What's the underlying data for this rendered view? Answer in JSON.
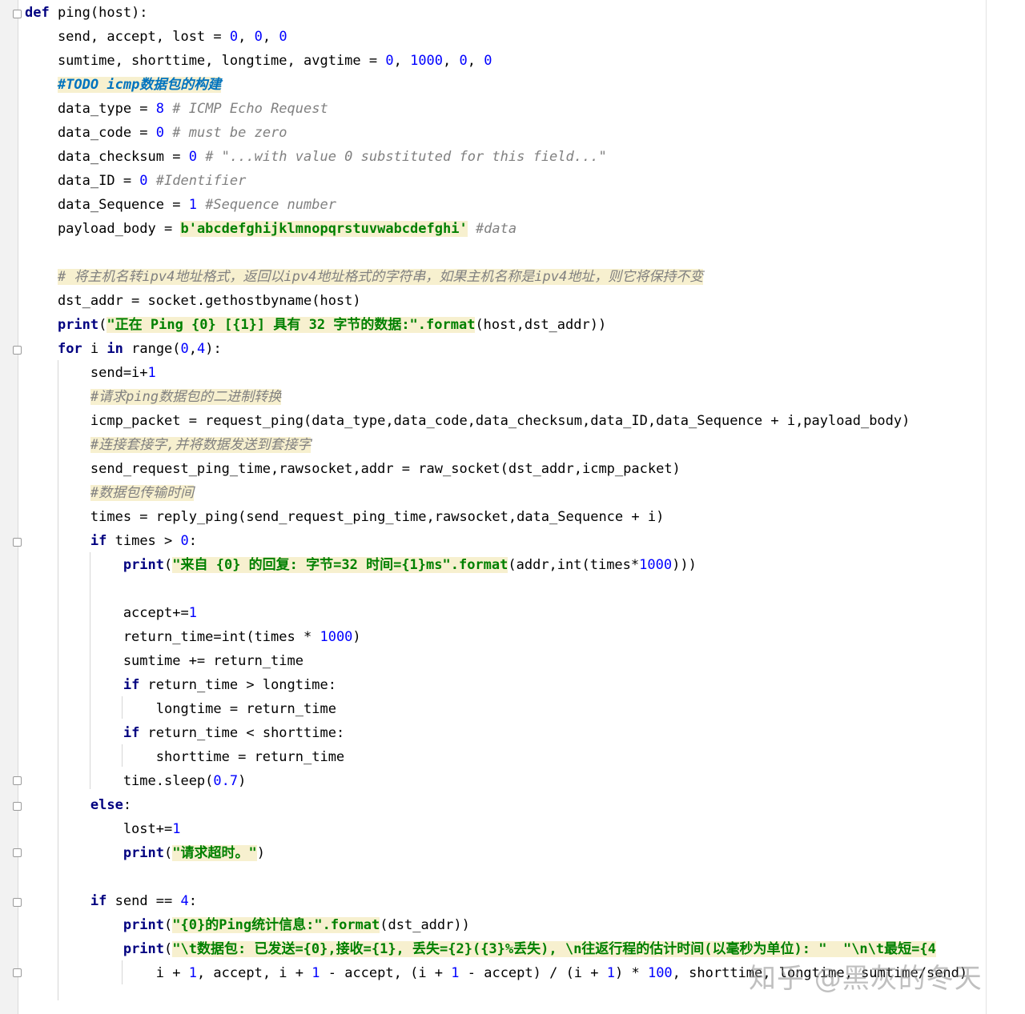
{
  "editor": {
    "lines": [
      [
        {
          "t": "def",
          "c": "kw"
        },
        {
          "t": " ping(host):"
        }
      ],
      [
        {
          "t": "    send, accept, lost = "
        },
        {
          "t": "0",
          "c": "num"
        },
        {
          "t": ", "
        },
        {
          "t": "0",
          "c": "num"
        },
        {
          "t": ", "
        },
        {
          "t": "0",
          "c": "num"
        }
      ],
      [
        {
          "t": "    sumtime, shorttime, longtime, avgtime = "
        },
        {
          "t": "0",
          "c": "num"
        },
        {
          "t": ", "
        },
        {
          "t": "1000",
          "c": "num"
        },
        {
          "t": ", "
        },
        {
          "t": "0",
          "c": "num"
        },
        {
          "t": ", "
        },
        {
          "t": "0",
          "c": "num"
        }
      ],
      [
        {
          "t": "    "
        },
        {
          "t": "#TODO icmp数据包的构建",
          "c": "todo"
        }
      ],
      [
        {
          "t": "    data_type = "
        },
        {
          "t": "8",
          "c": "num"
        },
        {
          "t": " # ICMP Echo Request",
          "c": "cmt"
        }
      ],
      [
        {
          "t": "    data_code = "
        },
        {
          "t": "0",
          "c": "num"
        },
        {
          "t": " # must be zero",
          "c": "cmt"
        }
      ],
      [
        {
          "t": "    data_checksum = "
        },
        {
          "t": "0",
          "c": "num"
        },
        {
          "t": " # \"...with value 0 substituted for this field...\"",
          "c": "cmt"
        }
      ],
      [
        {
          "t": "    data_ID = "
        },
        {
          "t": "0",
          "c": "num"
        },
        {
          "t": " #Identifier",
          "c": "cmt"
        }
      ],
      [
        {
          "t": "    data_Sequence = "
        },
        {
          "t": "1",
          "c": "num"
        },
        {
          "t": " #Sequence number",
          "c": "cmt"
        }
      ],
      [
        {
          "t": "    payload_body = "
        },
        {
          "t": "b'abcdefghijklmnopqrstuvwabcdefghi'",
          "c": "str"
        },
        {
          "t": " #data",
          "c": "cmt"
        }
      ],
      [
        {
          "t": ""
        }
      ],
      [
        {
          "t": "    "
        },
        {
          "t": "# 将主机名转ipv4地址格式，返回以ipv4地址格式的字符串，如果主机名称是ipv4地址，则它将保持不变",
          "c": "cmt-hl"
        }
      ],
      [
        {
          "t": "    dst_addr = socket.gethostbyname(host)"
        }
      ],
      [
        {
          "t": "    "
        },
        {
          "t": "print",
          "c": "kw"
        },
        {
          "t": "("
        },
        {
          "t": "\"正在 Ping {0} [{1}] 具有 32 字节的数据:\".format",
          "c": "str"
        },
        {
          "t": "(host,dst_addr))"
        }
      ],
      [
        {
          "t": "    "
        },
        {
          "t": "for",
          "c": "kw"
        },
        {
          "t": " i "
        },
        {
          "t": "in",
          "c": "kw"
        },
        {
          "t": " range("
        },
        {
          "t": "0",
          "c": "num"
        },
        {
          "t": ","
        },
        {
          "t": "4",
          "c": "num"
        },
        {
          "t": "):"
        }
      ],
      [
        {
          "t": "        send=i+"
        },
        {
          "t": "1",
          "c": "num"
        }
      ],
      [
        {
          "t": "        "
        },
        {
          "t": "#请求ping数据包的二进制转换",
          "c": "cmt-hl"
        }
      ],
      [
        {
          "t": "        icmp_packet = request_ping(data_type,data_code,data_checksum,data_ID,data_Sequence + i,payload_body)"
        }
      ],
      [
        {
          "t": "        "
        },
        {
          "t": "#连接套接字,并将数据发送到套接字",
          "c": "cmt-hl"
        }
      ],
      [
        {
          "t": "        send_request_ping_time,rawsocket,addr = raw_socket(dst_addr,icmp_packet)"
        }
      ],
      [
        {
          "t": "        "
        },
        {
          "t": "#数据包传输时间",
          "c": "cmt-hl"
        }
      ],
      [
        {
          "t": "        times = reply_ping(send_request_ping_time,rawsocket,data_Sequence + i)"
        }
      ],
      [
        {
          "t": "        "
        },
        {
          "t": "if",
          "c": "kw"
        },
        {
          "t": " times > "
        },
        {
          "t": "0",
          "c": "num"
        },
        {
          "t": ":"
        }
      ],
      [
        {
          "t": "            "
        },
        {
          "t": "print",
          "c": "kw"
        },
        {
          "t": "("
        },
        {
          "t": "\"来自 {0} 的回复: 字节=32 时间={1}ms\".format",
          "c": "str"
        },
        {
          "t": "(addr,int(times*"
        },
        {
          "t": "1000",
          "c": "num"
        },
        {
          "t": ")))"
        }
      ],
      [
        {
          "t": ""
        }
      ],
      [
        {
          "t": "            accept+="
        },
        {
          "t": "1",
          "c": "num"
        }
      ],
      [
        {
          "t": "            return_time=int(times * "
        },
        {
          "t": "1000",
          "c": "num"
        },
        {
          "t": ")"
        }
      ],
      [
        {
          "t": "            sumtime += return_time"
        }
      ],
      [
        {
          "t": "            "
        },
        {
          "t": "if",
          "c": "kw"
        },
        {
          "t": " return_time > longtime:"
        }
      ],
      [
        {
          "t": "                longtime = return_time"
        }
      ],
      [
        {
          "t": "            "
        },
        {
          "t": "if",
          "c": "kw"
        },
        {
          "t": " return_time < shorttime:"
        }
      ],
      [
        {
          "t": "                shorttime = return_time"
        }
      ],
      [
        {
          "t": "            time.sleep("
        },
        {
          "t": "0.7",
          "c": "num"
        },
        {
          "t": ")"
        }
      ],
      [
        {
          "t": "        "
        },
        {
          "t": "else",
          "c": "kw"
        },
        {
          "t": ":"
        }
      ],
      [
        {
          "t": "            lost+="
        },
        {
          "t": "1",
          "c": "num"
        }
      ],
      [
        {
          "t": "            "
        },
        {
          "t": "print",
          "c": "kw"
        },
        {
          "t": "("
        },
        {
          "t": "\"请求超时。\"",
          "c": "str"
        },
        {
          "t": ")"
        }
      ],
      [
        {
          "t": ""
        }
      ],
      [
        {
          "t": "        "
        },
        {
          "t": "if",
          "c": "kw"
        },
        {
          "t": " send == "
        },
        {
          "t": "4",
          "c": "num"
        },
        {
          "t": ":"
        }
      ],
      [
        {
          "t": "            "
        },
        {
          "t": "print",
          "c": "kw"
        },
        {
          "t": "("
        },
        {
          "t": "\"{0}的Ping统计信息:\".format",
          "c": "str"
        },
        {
          "t": "(dst_addr))"
        }
      ],
      [
        {
          "t": "            "
        },
        {
          "t": "print",
          "c": "kw"
        },
        {
          "t": "("
        },
        {
          "t": "\"\\t数据包: 已发送={0},接收={1}, 丢失={2}({3}%丢失), \\n往返行程的估计时间(以毫秒为单位): \"  \"\\n\\t最短={4",
          "c": "str"
        }
      ],
      [
        {
          "t": "                i + "
        },
        {
          "t": "1",
          "c": "num"
        },
        {
          "t": ", accept, i + "
        },
        {
          "t": "1",
          "c": "num"
        },
        {
          "t": " - accept, (i + "
        },
        {
          "t": "1",
          "c": "num"
        },
        {
          "t": " - accept) / (i + "
        },
        {
          "t": "1",
          "c": "num"
        },
        {
          "t": ") * "
        },
        {
          "t": "100",
          "c": "num"
        },
        {
          "t": ", shorttime, longtime, sumtime/send)"
        }
      ]
    ]
  },
  "watermark": "知乎 @黑灰的冬天",
  "colors": {
    "keyword": "#000080",
    "number": "#0000ff",
    "string": "#008000",
    "comment": "#808080",
    "todo": "#0073bf",
    "highlight": "#f7f0cf"
  }
}
